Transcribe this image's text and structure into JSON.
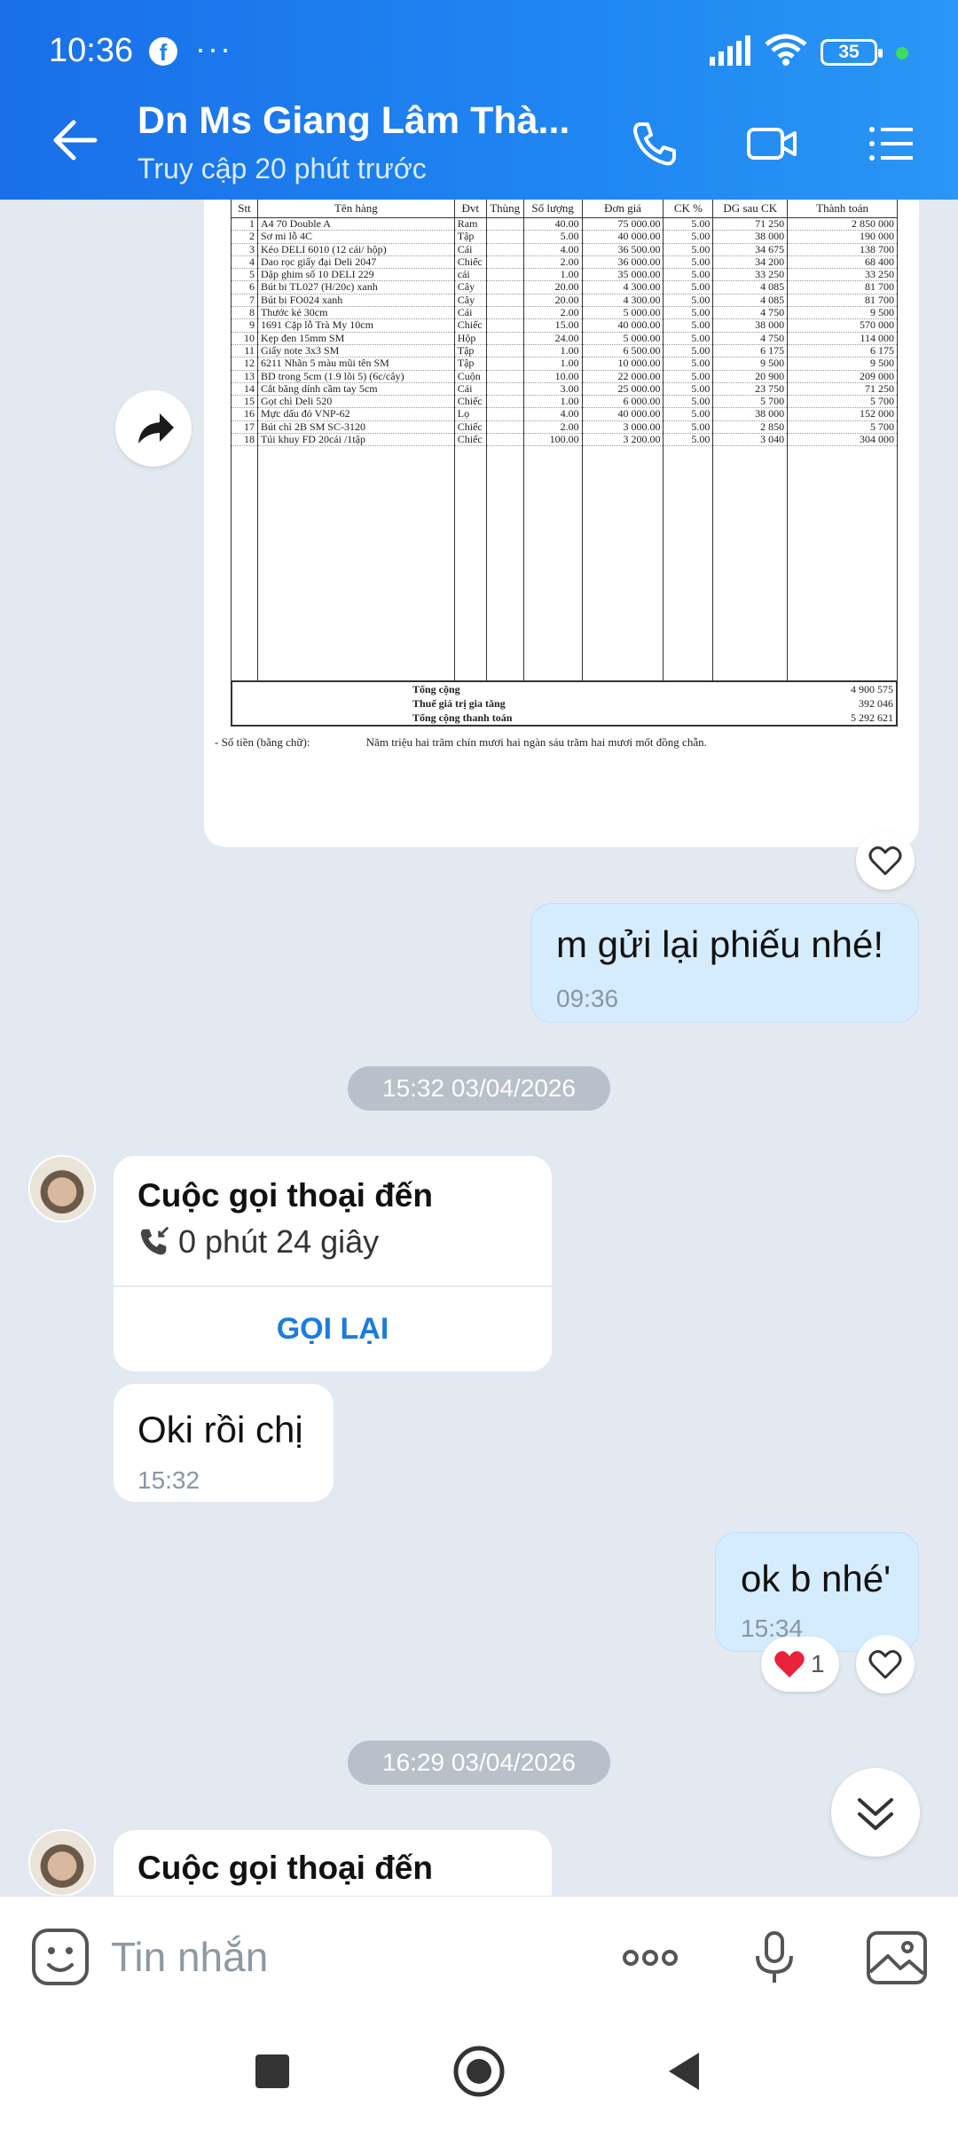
{
  "status_bar": {
    "time": "10:36",
    "dots": "···",
    "battery": "35"
  },
  "header": {
    "title": "Dn Ms Giang Lâm Thà...",
    "subtitle": "Truy cập 20 phút trước"
  },
  "document": {
    "headers": [
      "Stt",
      "Tên hàng",
      "Đvt",
      "Thùng",
      "Số lượng",
      "Đơn giá",
      "CK %",
      "DG sau CK",
      "Thành toán"
    ],
    "rows": [
      [
        "1",
        "A4 70 Double A",
        "Ram",
        "",
        "40.00",
        "75 000.00",
        "5.00",
        "71 250",
        "2 850 000"
      ],
      [
        "2",
        "Sơ mi lỗ 4C",
        "Tập",
        "",
        "5.00",
        "40 000.00",
        "5.00",
        "38 000",
        "190 000"
      ],
      [
        "3",
        "Kéo DELI 6010 (12 cái/ hộp)",
        "Cái",
        "",
        "4.00",
        "36 500.00",
        "5.00",
        "34 675",
        "138 700"
      ],
      [
        "4",
        "Dao rọc giấy đại Deli 2047",
        "Chiếc",
        "",
        "2.00",
        "36 000.00",
        "5.00",
        "34 200",
        "68 400"
      ],
      [
        "5",
        "Dập ghim số 10 DELI 229",
        "cái",
        "",
        "1.00",
        "35 000.00",
        "5.00",
        "33 250",
        "33 250"
      ],
      [
        "6",
        "Bút bi TL027 (H/20c) xanh",
        "Cây",
        "",
        "20.00",
        "4 300.00",
        "5.00",
        "4 085",
        "81 700"
      ],
      [
        "7",
        "Bút bi FO024 xanh",
        "Cây",
        "",
        "20.00",
        "4 300.00",
        "5.00",
        "4 085",
        "81 700"
      ],
      [
        "8",
        "Thước kẻ 30cm",
        "Cái",
        "",
        "2.00",
        "5 000.00",
        "5.00",
        "4 750",
        "9 500"
      ],
      [
        "9",
        "1691 Cặp lỗ Trà My 10cm",
        "Chiếc",
        "",
        "15.00",
        "40 000.00",
        "5.00",
        "38 000",
        "570 000"
      ],
      [
        "10",
        "Kẹp đen 15mm SM",
        "Hộp",
        "",
        "24.00",
        "5 000.00",
        "5.00",
        "4 750",
        "114 000"
      ],
      [
        "11",
        "Giấy note 3x3 SM",
        "Tập",
        "",
        "1.00",
        "6 500.00",
        "5.00",
        "6 175",
        "6 175"
      ],
      [
        "12",
        "6211 Nhãn 5 màu mũi tên SM",
        "Tập",
        "",
        "1.00",
        "10 000.00",
        "5.00",
        "9 500",
        "9 500"
      ],
      [
        "13",
        "BD trong 5cm (1.9 lõi 5) (6c/cây)",
        "Cuộn",
        "",
        "10.00",
        "22 000.00",
        "5.00",
        "20 900",
        "209 000"
      ],
      [
        "14",
        "Cắt băng dính cầm tay 5cm",
        "Cái",
        "",
        "3.00",
        "25 000.00",
        "5.00",
        "23 750",
        "71 250"
      ],
      [
        "15",
        "Gọt chì Deli 520",
        "Chiếc",
        "",
        "1.00",
        "6 000.00",
        "5.00",
        "5 700",
        "5 700"
      ],
      [
        "16",
        "Mực dấu đỏ VNP-62",
        "Lọ",
        "",
        "4.00",
        "40 000.00",
        "5.00",
        "38 000",
        "152 000"
      ],
      [
        "17",
        "Bút chì 2B SM SC-3120",
        "Chiếc",
        "",
        "2.00",
        "3 000.00",
        "5.00",
        "2 850",
        "5 700"
      ],
      [
        "18",
        "Túi khuy FD 20cái /1tập",
        "Chiếc",
        "",
        "100.00",
        "3 200.00",
        "5.00",
        "3 040",
        "304 000"
      ]
    ],
    "total_label": "Tổng cộng",
    "total_value": "4 900 575",
    "vat_label": "Thuế giá trị gia tăng",
    "vat_value": "392 046",
    "grand_label": "Tổng cộng thanh toán",
    "grand_value": "5 292 621",
    "words_label": "- Số tiền (bằng chữ):",
    "words_value": "Năm triệu hai trăm chín mươi hai ngàn sáu trăm hai mươi mốt đồng chẵn."
  },
  "messages": {
    "out1_text": "m gửi lại phiếu nhé!",
    "out1_time": "09:36",
    "date1": "15:32 03/04/2026",
    "call1_title": "Cuộc gọi thoại đến",
    "call1_duration": "0 phút 24 giây",
    "call1_action": "GỌI LẠI",
    "in1_text": "Oki rồi chị",
    "in1_time": "15:32",
    "out2_text": "ok b nhé'",
    "out2_time": "15:34",
    "reaction_count": "1",
    "date2": "16:29 03/04/2026",
    "call2_title": "Cuộc gọi thoại đến"
  },
  "composer": {
    "placeholder": "Tin nhắn"
  },
  "colors": {
    "header": "#1f7ff0",
    "accent": "#1a7cdd",
    "chat_bg": "#e2e9f1",
    "outgoing_bubble": "#d5ecfe"
  }
}
